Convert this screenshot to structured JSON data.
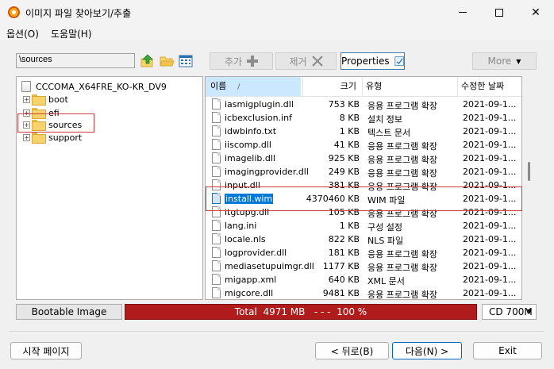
{
  "window": {
    "title": "이미지 파일 찾아보기/추출",
    "min_symbol": "—",
    "close_symbol": "✕"
  },
  "menu": [
    "옵션(O)",
    "도움말(H)"
  ],
  "toolbar": {
    "path_value": "\\sources",
    "add_label": "추가",
    "remove_label": "제거",
    "properties_label": "Properties",
    "more_label": "More"
  },
  "tree": {
    "root": "CCCOMA_X64FRE_KO-KR_DV9",
    "folders": [
      "boot",
      "efi",
      "sources",
      "support"
    ],
    "selected": "sources"
  },
  "list": {
    "headers": {
      "name": "이름",
      "size": "크기",
      "type": "유형",
      "date": "수정한 날짜"
    },
    "rows": [
      {
        "name": "iasmigplugin.dll",
        "size": "753 KB",
        "type": "응용 프로그램 확장",
        "date": "2021-09-1..."
      },
      {
        "name": "icbexclusion.inf",
        "size": "8 KB",
        "type": "설치 정보",
        "date": "2021-09-1..."
      },
      {
        "name": "idwbinfo.txt",
        "size": "1 KB",
        "type": "텍스트 문서",
        "date": "2021-09-1..."
      },
      {
        "name": "iiscomp.dll",
        "size": "41 KB",
        "type": "응용 프로그램 확장",
        "date": "2021-09-1..."
      },
      {
        "name": "imagelib.dll",
        "size": "925 KB",
        "type": "응용 프로그램 확장",
        "date": "2021-09-1..."
      },
      {
        "name": "imagingprovider.dll",
        "size": "249 KB",
        "type": "응용 프로그램 확장",
        "date": "2021-09-1..."
      },
      {
        "name": "input.dll",
        "size": "381 KB",
        "type": "응용 프로그램 확장",
        "date": "2021-09-1..."
      },
      {
        "name": "install.wim",
        "size": "4370460 KB",
        "type": "WIM 파일",
        "date": "2021-09-1...",
        "selected": true
      },
      {
        "name": "itgtupg.dll",
        "size": "105 KB",
        "type": "응용 프로그램 확장",
        "date": "2021-09-1..."
      },
      {
        "name": "lang.ini",
        "size": "1 KB",
        "type": "구성 설정",
        "date": "2021-09-1..."
      },
      {
        "name": "locale.nls",
        "size": "822 KB",
        "type": "NLS 파일",
        "date": "2021-09-1..."
      },
      {
        "name": "logprovider.dll",
        "size": "181 KB",
        "type": "응용 프로그램 확장",
        "date": "2021-09-1..."
      },
      {
        "name": "mediasetupuimgr.dll",
        "size": "1177 KB",
        "type": "응용 프로그램 확장",
        "date": "2021-09-1..."
      },
      {
        "name": "migapp.xml",
        "size": "640 KB",
        "type": "XML 문서",
        "date": "2021-09-1..."
      },
      {
        "name": "migcore.dll",
        "size": "9481 KB",
        "type": "응용 프로그램 확장",
        "date": "2021-09-1..."
      }
    ]
  },
  "status": {
    "boot_label": "Bootable Image",
    "progress_text": "Total  4971 MB   - - -  100 %",
    "progress_percent": 100,
    "media": "CD 700M"
  },
  "buttons": {
    "start": "시작 페이지",
    "back": "< 뒤로(B)",
    "next": "다음(N) >",
    "exit": "Exit"
  },
  "colors": {
    "highlight_box": "#d23b3b",
    "progress": "#b01c1c",
    "selection": "#0078d7"
  }
}
